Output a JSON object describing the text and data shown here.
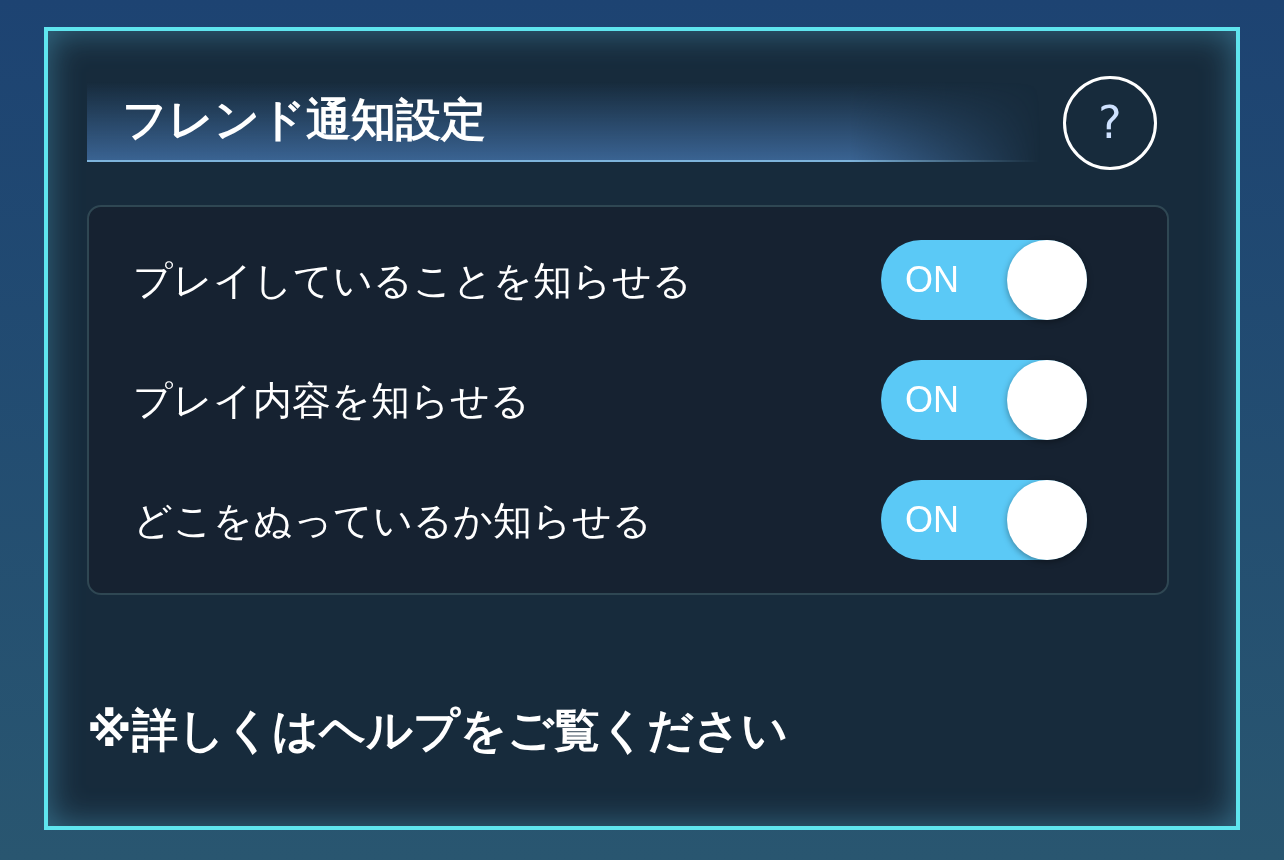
{
  "title": "フレンド通知設定",
  "help_button": {
    "label": "?"
  },
  "settings": [
    {
      "label": "プレイしていることを知らせる",
      "on": true,
      "toggle_text": "ON"
    },
    {
      "label": "プレイ内容を知らせる",
      "on": true,
      "toggle_text": "ON"
    },
    {
      "label": "どこをぬっているか知らせる",
      "on": true,
      "toggle_text": "ON"
    }
  ],
  "note": "※詳しくはヘルプをご覧ください"
}
